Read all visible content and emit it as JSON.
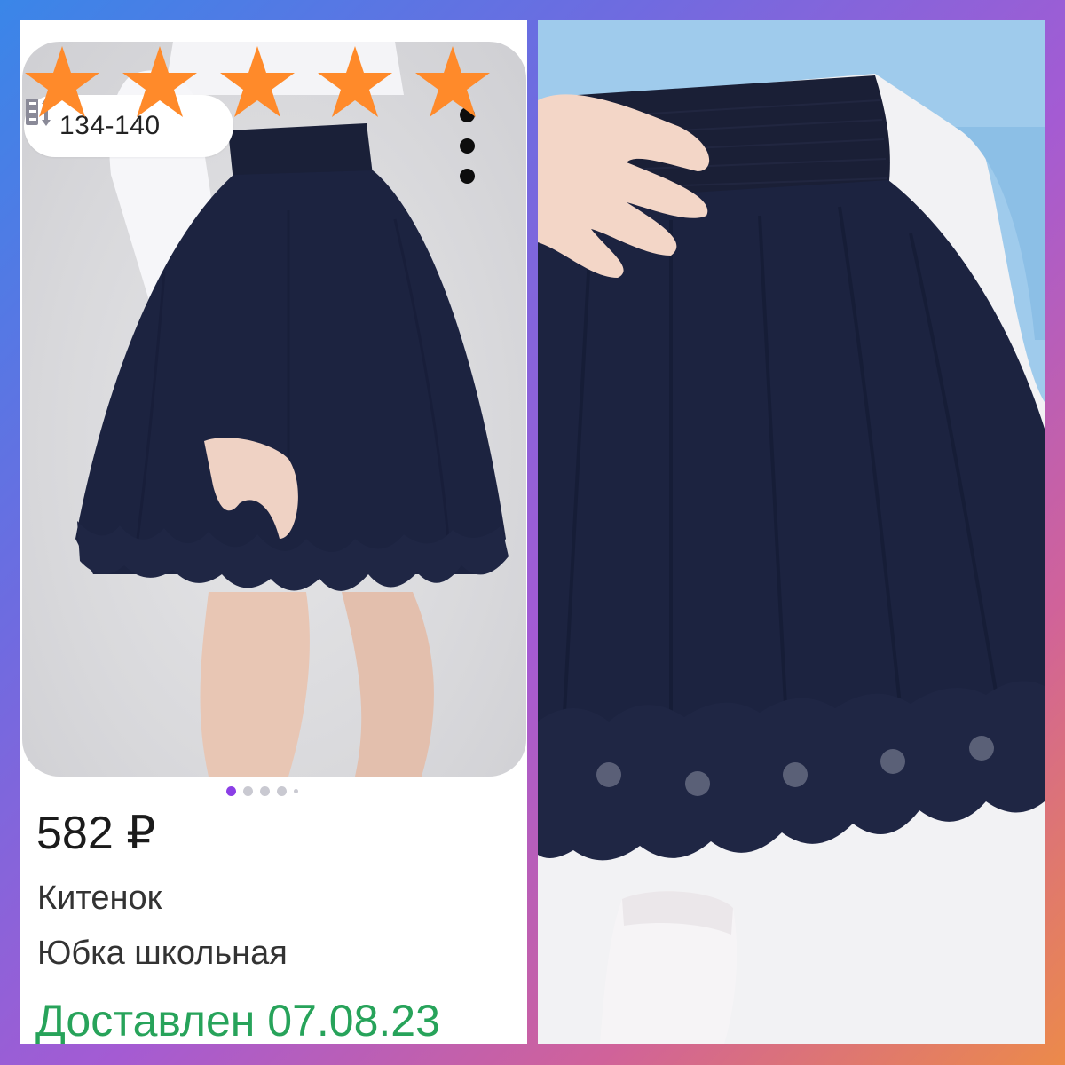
{
  "product_card": {
    "size_chip": {
      "icon": "size-height-icon",
      "label": "134-140"
    },
    "menu_icon": "kebab-menu-icon",
    "rating": {
      "stars": 5,
      "max": 5,
      "star_color": "#ff8a2a"
    },
    "carousel": {
      "current": 1,
      "total": 5
    },
    "price": "582 ₽",
    "brand": "Китенок",
    "name": "Юбка школьная",
    "status": "Доставлен 07.08.23",
    "status_color": "#27a35a"
  },
  "colors": {
    "skirt": "#1c2340",
    "accent": "#8b3fe6"
  }
}
